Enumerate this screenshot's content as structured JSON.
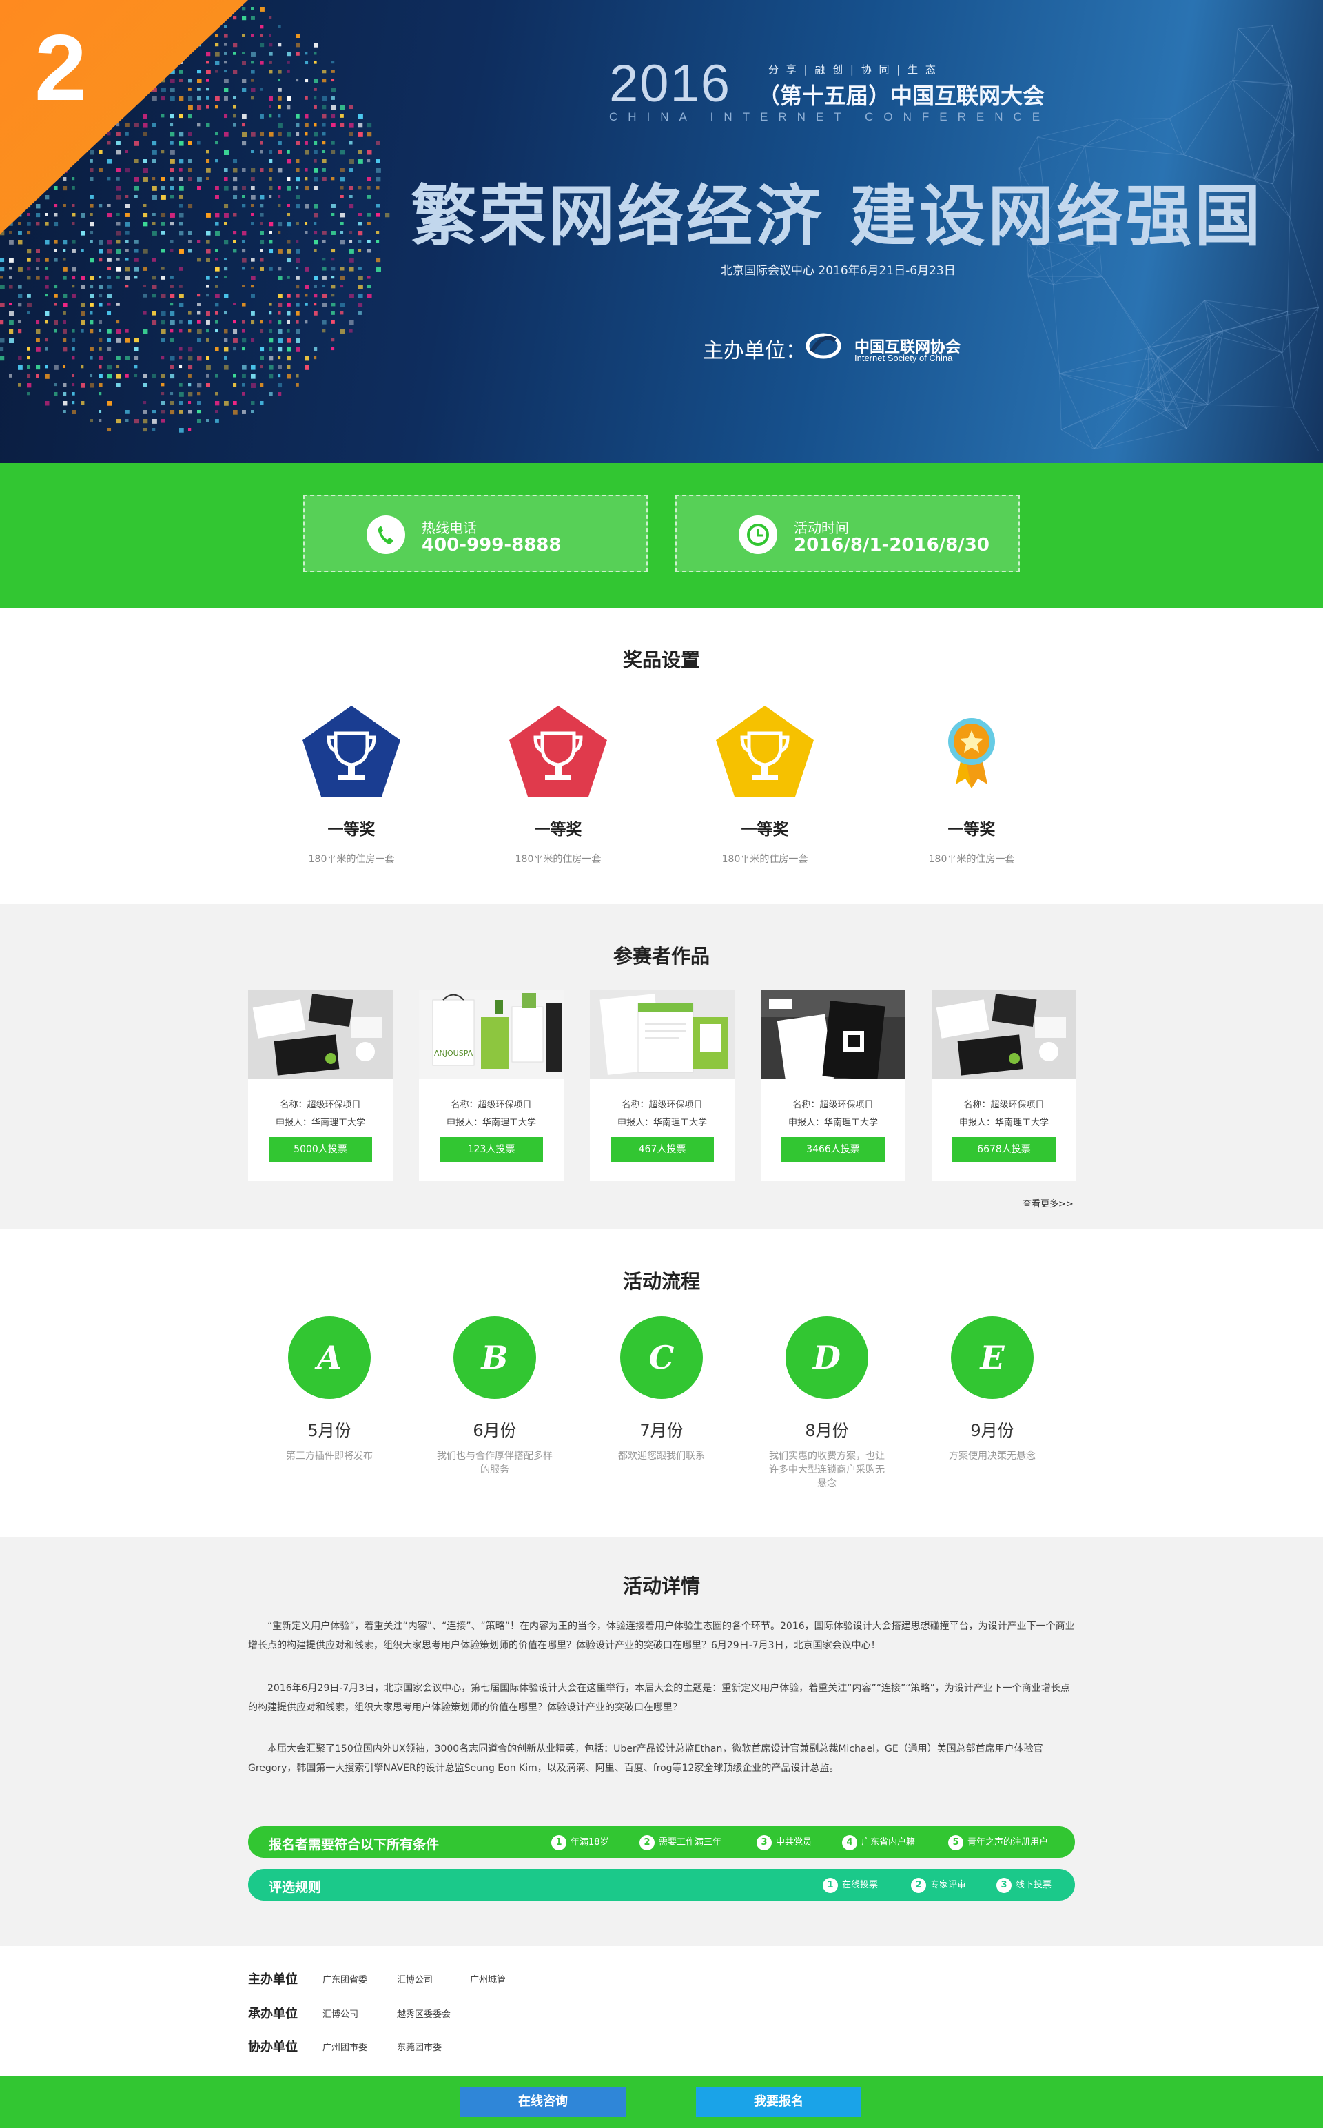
{
  "hero": {
    "badge_number": "2",
    "year": "2016",
    "tags": "分 享 | 融 创 | 协 同 | 生 态",
    "conference_name": "（第十五届）中国互联网大会",
    "conference_en": "CHINA INTERNET CONFERENCE",
    "slogan": "繁荣网络经济  建设网络强国",
    "venue": "北京国际会议中心  2016年6月21日-6月23日",
    "host_label": "主办单位：",
    "host_name": "中国互联网协会",
    "host_name_en": "Internet Society of China"
  },
  "info": {
    "hotline_label": "热线电话",
    "hotline_value": "400-999-8888",
    "time_label": "活动时间",
    "time_value": "2016/8/1-2016/8/30"
  },
  "prizes": {
    "title": "奖品设置",
    "items": [
      {
        "name": "一等奖",
        "desc": "180平米的住房一套",
        "color": "#1a3d91"
      },
      {
        "name": "一等奖",
        "desc": "180平米的住房一套",
        "color": "#e03a4c"
      },
      {
        "name": "一等奖",
        "desc": "180平米的住房一套",
        "color": "#f6c100"
      },
      {
        "name": "一等奖",
        "desc": "180平米的住房一套",
        "color": "#f39c12"
      }
    ]
  },
  "works": {
    "title": "参赛者作品",
    "items": [
      {
        "name": "名称：超级环保项目",
        "author": "申报人：华南理工大学",
        "votes": "5000人投票"
      },
      {
        "name": "名称：超级环保项目",
        "author": "申报人：华南理工大学",
        "votes": "123人投票"
      },
      {
        "name": "名称：超级环保项目",
        "author": "申报人：华南理工大学",
        "votes": "467人投票"
      },
      {
        "name": "名称：超级环保项目",
        "author": "申报人：华南理工大学",
        "votes": "3466人投票"
      },
      {
        "name": "名称：超级环保项目",
        "author": "申报人：华南理工大学",
        "votes": "6678人投票"
      }
    ],
    "thumb_brand": "ANJOUSPA",
    "more": "查看更多>>"
  },
  "process": {
    "title": "活动流程",
    "steps": [
      {
        "letter": "A",
        "month": "5月份",
        "desc": "第三方插件即将发布"
      },
      {
        "letter": "B",
        "month": "6月份",
        "desc": "我们也与合作厚伴搭配多样的服务"
      },
      {
        "letter": "C",
        "month": "7月份",
        "desc": "都欢迎您跟我们联系"
      },
      {
        "letter": "D",
        "month": "8月份",
        "desc": "我们实惠的收费方案，也让许多中大型连锁商户采购无悬念"
      },
      {
        "letter": "E",
        "month": "9月份",
        "desc": "方案使用决策无悬念"
      }
    ]
  },
  "details": {
    "title": "活动详情",
    "paragraphs": [
      "“重新定义用户体验”，着重关注“内容”、“连接”、“策略”！在内容为王的当今，体验连接着用户体验生态圈的各个环节。2016，国际体验设计大会搭建思想碰撞平台，为设计产业下一个商业增长点的构建提供应对和线索，组织大家思考用户体验策划师的价值在哪里？体验设计产业的突破口在哪里？6月29日-7月3日，北京国家会议中心！",
      "2016年6月29日-7月3日，北京国家会议中心，第七届国际体验设计大会在这里举行，本届大会的主题是：重新定义用户体验，着重关注“内容”“连接”“策略”，为设计产业下一个商业增长点的构建提供应对和线索，组织大家思考用户体验策划师的价值在哪里？体验设计产业的突破口在哪里？",
      "本届大会汇聚了150位国内外UX领袖，3000名志同道合的创新从业精英，包括：Uber产品设计总监Ethan，微软首席设计官兼副总裁Michael，GE（通用）美国总部首席用户体验官Gregory，韩国第一大搜索引擎NAVER的设计总监Seung Eon Kim，以及滴滴、阿里、百度、frog等12家全球顶级企业的产品设计总监。"
    ],
    "requirements": {
      "title": "报名者需要符合以下所有条件",
      "items": [
        "年满18岁",
        "需要工作满三年",
        "中共党员",
        "广东省内户籍",
        "青年之声的注册用户"
      ]
    },
    "rules": {
      "title": "评选规则",
      "items": [
        "在线投票",
        "专家评审",
        "线下投票"
      ]
    }
  },
  "organizers": {
    "host_label": "主办单位",
    "hosts": [
      "广东团省委",
      "汇博公司",
      "广州城管"
    ],
    "undertaker_label": "承办单位",
    "undertakers": [
      "汇博公司",
      "越秀区委委会"
    ],
    "co_label": "协办单位",
    "co": [
      "广州团市委",
      "东莞团市委"
    ]
  },
  "footer": {
    "consult": "在线咨询",
    "signup": "我要报名"
  }
}
